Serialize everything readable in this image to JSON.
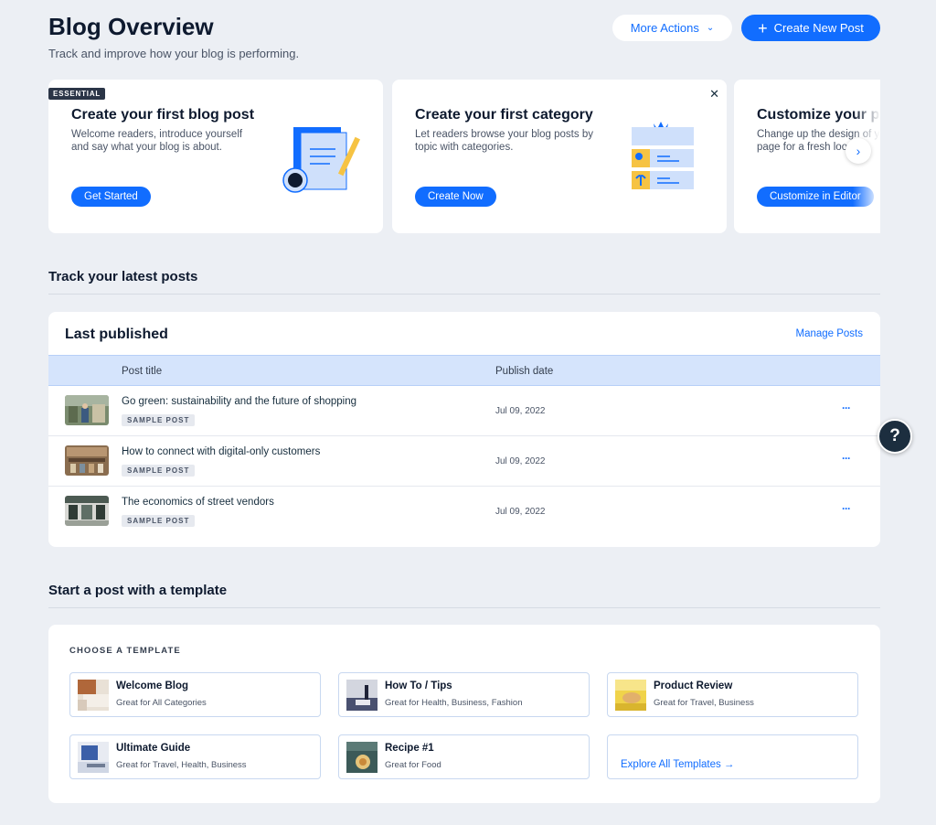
{
  "header": {
    "title": "Blog Overview",
    "subtitle": "Track and improve how your blog is performing.",
    "more_actions_label": "More Actions",
    "create_post_label": "Create New Post"
  },
  "cards": [
    {
      "badge": "ESSENTIAL",
      "title": "Create your first blog post",
      "description": "Welcome readers, introduce yourself and say what your blog is about.",
      "button": "Get Started"
    },
    {
      "title": "Create your first category",
      "description": "Let readers browse your blog posts by topic with categories.",
      "button": "Create Now"
    },
    {
      "title": "Customize your p",
      "description": "Change up the design of y page for a fresh loo",
      "button": "Customize in Editor"
    }
  ],
  "latest_posts": {
    "section_title": "Track your latest posts",
    "panel_title": "Last published",
    "manage_link": "Manage Posts",
    "columns": [
      "Post title",
      "Publish date"
    ],
    "rows": [
      {
        "title": "Go green: sustainability and the future of shopping",
        "badge": "SAMPLE POST",
        "date": "Jul 09, 2022",
        "more": "···"
      },
      {
        "title": "How to connect with digital-only customers",
        "badge": "SAMPLE POST",
        "date": "Jul 09, 2022",
        "more": "···"
      },
      {
        "title": "The economics of street vendors",
        "badge": "SAMPLE POST",
        "date": "Jul 09, 2022",
        "more": "···"
      }
    ]
  },
  "templates": {
    "section_title": "Start a post with a template",
    "choose_label": "CHOOSE A TEMPLATE",
    "items": [
      {
        "name": "Welcome Blog",
        "desc": "Great for All Categories"
      },
      {
        "name": "How To / Tips",
        "desc": "Great for Health, Business, Fashion"
      },
      {
        "name": "Product Review",
        "desc": "Great for Travel, Business"
      },
      {
        "name": "Ultimate Guide",
        "desc": "Great for Travel, Health, Business"
      },
      {
        "name": "Recipe #1",
        "desc": "Great for Food"
      }
    ],
    "explore_label": "Explore All Templates →"
  },
  "help": {
    "label": "?"
  },
  "icons": {
    "close": "close-icon",
    "next": "chevron-right-icon",
    "plus": "plus-icon",
    "chevron_down": "chevron-down-icon"
  },
  "colors": {
    "accent": "#116dff",
    "background": "#eceff4",
    "table_header": "#d5e4fc",
    "badge_dark": "#2b3547"
  }
}
